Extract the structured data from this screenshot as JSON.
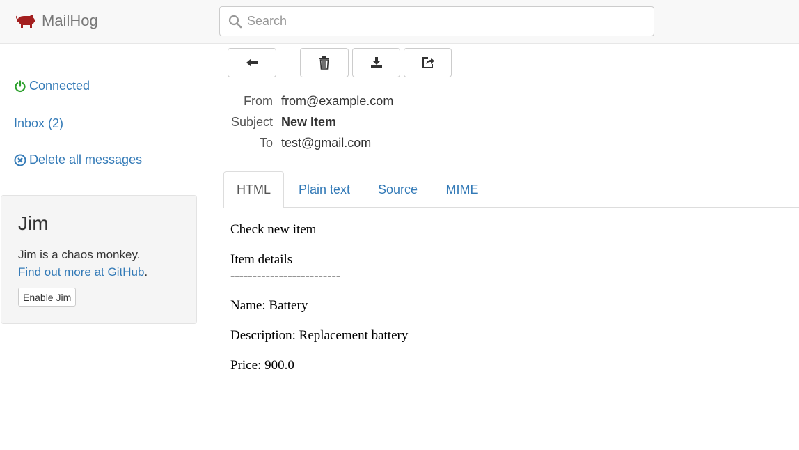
{
  "navbar": {
    "brand": "MailHog",
    "brand_icon": "pig-logo-icon",
    "brand_color": "#a31f1f",
    "search_placeholder": "Search"
  },
  "sidebar": {
    "connected_label": "Connected",
    "connected_color": "#2ca02c",
    "inbox_label": "Inbox (2)",
    "delete_all_label": "Delete all messages"
  },
  "jim": {
    "title": "Jim",
    "description": "Jim is a chaos monkey.",
    "link_text": "Find out more at GitHub",
    "link_suffix": ".",
    "button_label": "Enable Jim"
  },
  "toolbar": {
    "buttons": [
      "back-arrow-icon",
      "trash-icon",
      "download-icon",
      "share-icon"
    ]
  },
  "message": {
    "headers": {
      "from_label": "From",
      "from_value": "from@example.com",
      "subject_label": "Subject",
      "subject_value": "New Item",
      "to_label": "To",
      "to_value": "test@gmail.com"
    },
    "tabs": [
      {
        "label": "HTML",
        "active": true
      },
      {
        "label": "Plain text",
        "active": false
      },
      {
        "label": "Source",
        "active": false
      },
      {
        "label": "MIME",
        "active": false
      }
    ],
    "body": {
      "line1": "Check new item",
      "line2": "Item details",
      "line3": "-------------------------",
      "line4": "Name: Battery",
      "line5": "Description: Replacement battery",
      "line6": "Price: 900.0"
    }
  },
  "colors": {
    "link": "#337ab7",
    "navbar_bg": "#f8f8f8"
  }
}
